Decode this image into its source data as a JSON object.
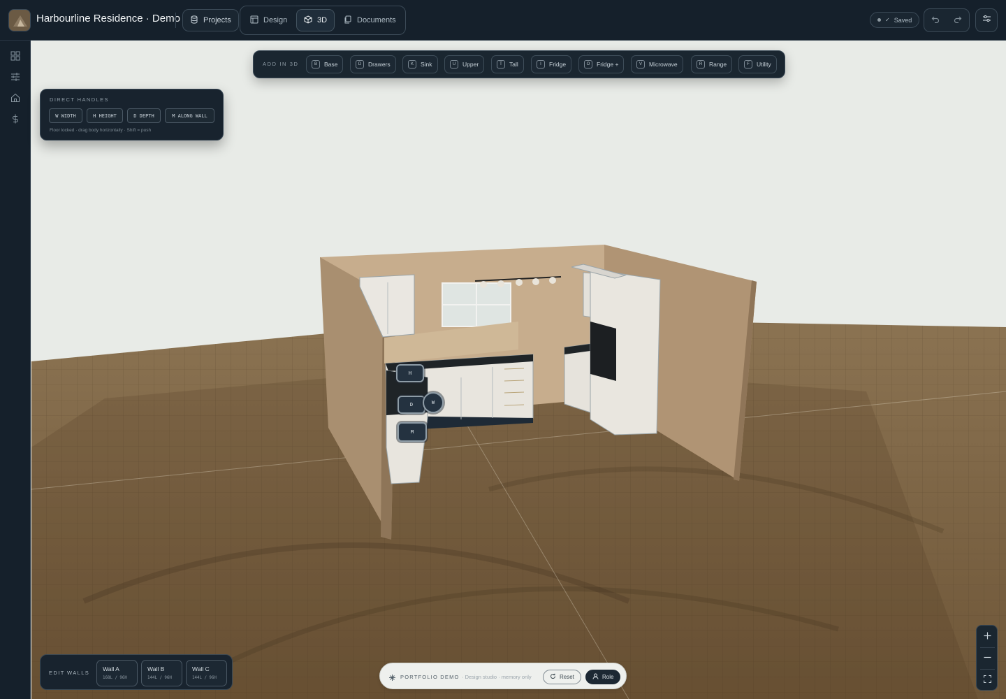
{
  "header": {
    "app_title": "Harbourline Residence · Demo",
    "projects_label": "Projects",
    "view_tabs": [
      {
        "label": "Design",
        "icon": "layout-icon"
      },
      {
        "label": "3D",
        "icon": "cube-icon",
        "active": true
      },
      {
        "label": "Documents",
        "icon": "documents-icon"
      }
    ],
    "saved_label": "Saved"
  },
  "sidebar": {
    "icons": [
      "grid-icon",
      "sliders-icon",
      "home-icon",
      "dollar-icon"
    ]
  },
  "add3d": {
    "label": "ADD IN 3D",
    "items": [
      {
        "key": "B",
        "label": "Base"
      },
      {
        "key": "D",
        "label": "Drawers"
      },
      {
        "key": "K",
        "label": "Sink"
      },
      {
        "key": "U",
        "label": "Upper"
      },
      {
        "key": "T",
        "label": "Tall"
      },
      {
        "key": "I",
        "label": "Fridge"
      },
      {
        "key": "O",
        "label": "Fridge +"
      },
      {
        "key": "V",
        "label": "Microwave"
      },
      {
        "key": "R",
        "label": "Range"
      },
      {
        "key": "F",
        "label": "Utility"
      }
    ]
  },
  "handles": {
    "title": "DIRECT HANDLES",
    "chips": [
      "W WIDTH",
      "H HEIGHT",
      "D DEPTH",
      "M ALONG WALL"
    ],
    "hint": "Floor locked · drag body horizontally · Shift = push"
  },
  "model_handles": {
    "h": "H",
    "d": "D",
    "w": "W",
    "m": "M"
  },
  "walls": {
    "title": "EDIT WALLS",
    "items": [
      {
        "name": "Wall A",
        "dims": "168L / 96H"
      },
      {
        "name": "Wall B",
        "dims": "144L / 96H"
      },
      {
        "name": "Wall C",
        "dims": "144L / 96H"
      }
    ]
  },
  "demo": {
    "label": "PORTFOLIO DEMO",
    "sub": "· Design studio · memory only",
    "reset_label": "Reset",
    "role_label": "Role"
  },
  "colors": {
    "chrome": "#15202b",
    "floor": "#7e6647",
    "wall": "#a58e70",
    "sky": "#e8ebe7"
  }
}
